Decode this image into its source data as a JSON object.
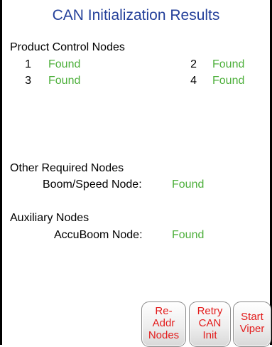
{
  "title": "CAN Initialization Results",
  "product_control": {
    "heading": "Product Control Nodes",
    "nodes": [
      {
        "num": "1",
        "status": "Found"
      },
      {
        "num": "2",
        "status": "Found"
      },
      {
        "num": "3",
        "status": "Found"
      },
      {
        "num": "4",
        "status": "Found"
      }
    ]
  },
  "other_required": {
    "heading": "Other Required Nodes",
    "label": "Boom/Speed Node:",
    "status": "Found"
  },
  "auxiliary": {
    "heading": "Auxiliary Nodes",
    "label": "AccuBoom Node:",
    "status": "Found"
  },
  "buttons": {
    "readdr": [
      "Re-",
      "Addr",
      "Nodes"
    ],
    "retry": [
      "Retry",
      "CAN",
      "Init"
    ],
    "start": [
      "Start",
      "Viper"
    ]
  },
  "colors": {
    "title": "#24409a",
    "found": "#4caf3a",
    "button_text": "#e31c1c"
  }
}
